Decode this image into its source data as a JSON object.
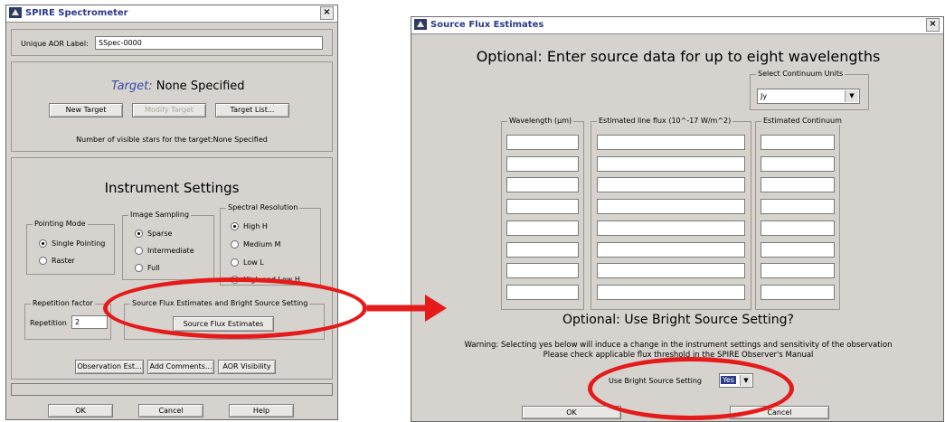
{
  "left_window": {
    "title": "SPIRE Spectrometer",
    "close_glyph": "×",
    "aor_label_caption": "Unique AOR Label:",
    "aor_label_value": "SSpec-0000",
    "target_prefix": "Target:",
    "target_value": "None Specified",
    "buttons": {
      "new_target": "New Target",
      "modify_target": "Modify Target",
      "target_list": "Target List..."
    },
    "visible_stars": "Number of visible stars for the target:None Specified",
    "instrument_heading": "Instrument Settings",
    "pointing_mode": {
      "legend": "Pointing Mode",
      "options": [
        "Single Pointing",
        "Raster"
      ],
      "selected": 0
    },
    "image_sampling": {
      "legend": "Image Sampling",
      "options": [
        "Sparse",
        "Intermediate",
        "Full"
      ],
      "selected": 0
    },
    "spectral_resolution": {
      "legend": "Spectral Resolution",
      "options": [
        "High H",
        "Medium M",
        "Low L",
        "High and Low H"
      ],
      "selected": 0
    },
    "repetition": {
      "legend": "Repetition factor",
      "caption": "Repetition",
      "value": "2"
    },
    "bright_source": {
      "legend": "Source Flux Estimates and Bright Source Setting",
      "button": "Source Flux Estimates"
    },
    "bottom_buttons": {
      "observation_est": "Observation Est...",
      "add_comments": "Add Comments...",
      "aor_visibility": "AOR Visibility"
    },
    "footer": {
      "ok": "OK",
      "cancel": "Cancel",
      "help": "Help"
    }
  },
  "right_window": {
    "title": "Source Flux Estimates",
    "close_glyph": "×",
    "heading": "Optional: Enter source data for up to eight wavelengths",
    "units": {
      "legend": "Select Continuum Units",
      "value": "Jy"
    },
    "columns": [
      "Wavelength (µm)",
      "Estimated line flux (10^-17 W/m^2)",
      "Estimated Continuum"
    ],
    "row_count": 8,
    "bright_heading": "Optional: Use Bright Source Setting?",
    "warning_line1": "Warning: Selecting yes below will induce a change in the instrument settings and sensitivity of the observation",
    "warning_line2": "Please check applicable flux threshold in the SPIRE Observer's Manual",
    "bright_caption": "Use Bright Source Setting",
    "bright_value": "Yes",
    "ok": "OK",
    "cancel": "Cancel"
  },
  "annotation_color": "#e51b1b"
}
